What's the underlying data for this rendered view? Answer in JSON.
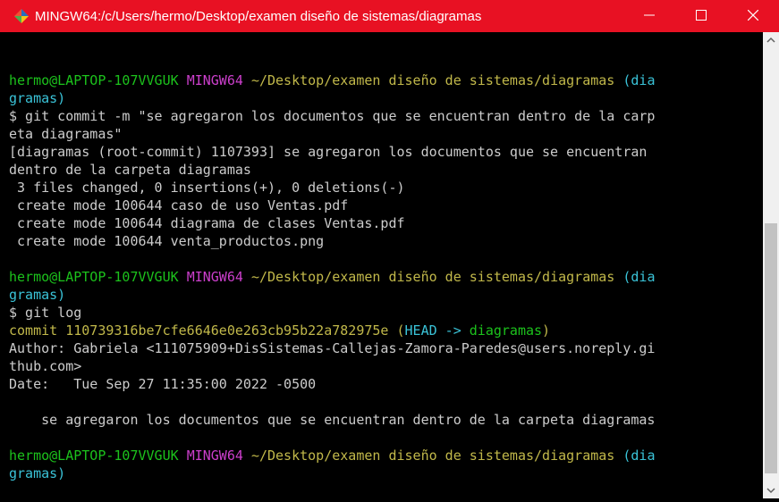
{
  "window": {
    "title": "MINGW64:/c/Users/hermo/Desktop/examen diseño de sistemas/diagramas",
    "app_icon": "git-bash-icon",
    "minimize_symbol": "—",
    "maximize_symbol": "☐",
    "close_symbol": "✕",
    "titlebar_color": "#e81123"
  },
  "prompt": {
    "user_host": "hermo@LAPTOP-107VVGUK",
    "shell": "MINGW64",
    "path_line1": "~/Desktop/examen diseño de sistemas/diagramas",
    "branch_part1": "(dia",
    "branch_part2": "gramas)"
  },
  "commands": {
    "commit_line1": "$ git commit -m \"se agregaron los documentos que se encuentran dentro de la carp",
    "commit_line2": "eta diagramas\"",
    "log": "$ git log"
  },
  "commit_output": {
    "line1": "[diagramas (root-commit) 1107393] se agregaron los documentos que se encuentran",
    "line2": "dentro de la carpeta diagramas",
    "summary": " 3 files changed, 0 insertions(+), 0 deletions(-)",
    "files": [
      " create mode 100644 caso de uso Ventas.pdf",
      " create mode 100644 diagrama de clases Ventas.pdf",
      " create mode 100644 venta_productos.png"
    ]
  },
  "log_output": {
    "commit_prefix": "commit 110739316be7cfe6646e0e263cb95b22a782975e (",
    "head_ref": "HEAD -> ",
    "branch_ref": "diagramas",
    "commit_suffix": ")",
    "author_line1": "Author: Gabriela <111075909+DisSistemas-Callejas-Zamora-Paredes@users.noreply.gi",
    "author_line2": "thub.com>",
    "date": "Date:   Tue Sep 27 11:35:00 2022 -0500",
    "message": "    se agregaron los documentos que se encuentran dentro de la carpeta diagramas"
  },
  "colors": {
    "prompt_green": "#1cc21c",
    "shell_magenta": "#cc3fcc",
    "path_yellow": "#c1b84a",
    "head_cyan": "#3ac3d8"
  }
}
